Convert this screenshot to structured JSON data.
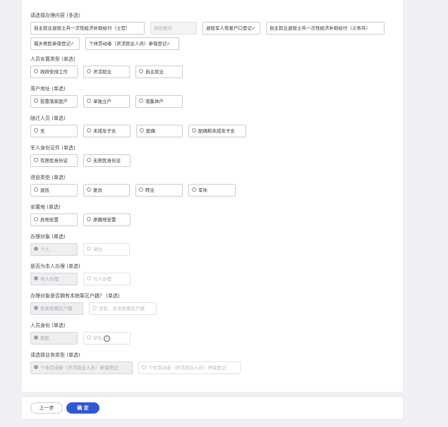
{
  "sections": [
    {
      "title": "请选择办理内容 (多选)",
      "options": [
        {
          "label": "自主就业退役士兵一次性经济补助给付（士官）",
          "state": "normal",
          "w": 162
        },
        {
          "label": "退役报到",
          "state": "disabled",
          "w": 66
        },
        {
          "label": "退役军人恢复户口登记",
          "state": "selected",
          "w": 82
        },
        {
          "label": "自主就业退役士兵一次性经济补助给付（义务兵）",
          "state": "normal",
          "w": 168
        },
        {
          "label": "城乡居民参保登记",
          "state": "selected",
          "w": 70
        },
        {
          "label": "个体劳动者（灵活就业人员）参保登记",
          "state": "selected",
          "w": 133
        }
      ]
    },
    {
      "title": "人员安置类型 (单选)",
      "options": [
        {
          "label": "政府安排工作",
          "state": "normal",
          "radio": true,
          "w": 67
        },
        {
          "label": "灵活就业",
          "state": "normal",
          "radio": true,
          "w": 66
        },
        {
          "label": "自主就业",
          "state": "normal",
          "radio": true,
          "w": 67
        }
      ]
    },
    {
      "title": "落户地址 (单选)",
      "options": [
        {
          "label": "投靠落家庭户",
          "state": "normal",
          "radio": true,
          "w": 67
        },
        {
          "label": "单独立户",
          "state": "normal",
          "radio": true,
          "w": 66
        },
        {
          "label": "落集体户",
          "state": "normal",
          "radio": true,
          "w": 67
        }
      ]
    },
    {
      "title": "随迁人员 (单选)",
      "options": [
        {
          "label": "无",
          "state": "normal",
          "radio": true,
          "w": 67
        },
        {
          "label": "未成年子女",
          "state": "normal",
          "radio": true,
          "w": 67
        },
        {
          "label": "配偶",
          "state": "normal",
          "radio": true,
          "w": 66
        },
        {
          "label": "配偶和未成年子女",
          "state": "normal",
          "radio": true,
          "w": 82
        }
      ]
    },
    {
      "title": "军人身份证件 (单选)",
      "options": [
        {
          "label": "有居民身份证",
          "state": "normal",
          "radio": true,
          "w": 67
        },
        {
          "label": "无居民身份证",
          "state": "normal",
          "radio": true,
          "w": 67
        }
      ]
    },
    {
      "title": "退役类型 (单选)",
      "options": [
        {
          "label": "退伍",
          "state": "normal",
          "radio": true,
          "w": 67
        },
        {
          "label": "复员",
          "state": "normal",
          "radio": true,
          "w": 66
        },
        {
          "label": "转业",
          "state": "normal",
          "radio": true,
          "w": 67
        },
        {
          "label": "军休",
          "state": "normal",
          "radio": true,
          "w": 67
        }
      ]
    },
    {
      "title": "安置地 (单选)",
      "options": [
        {
          "label": "异地安置",
          "state": "normal",
          "radio": true,
          "w": 67
        },
        {
          "label": "原籍地安置",
          "state": "normal",
          "radio": true,
          "w": 67
        }
      ]
    },
    {
      "title": "办理对象 (单选)",
      "options": [
        {
          "label": "个人",
          "state": "dis-sel",
          "radio": true,
          "w": 67
        },
        {
          "label": "单位",
          "state": "muted",
          "radio": true,
          "w": 66
        }
      ]
    },
    {
      "title": "是否为本人办理 (单选)",
      "options": [
        {
          "label": "本人办理",
          "state": "dis-sel",
          "radio": true,
          "w": 67
        },
        {
          "label": "代人办理",
          "state": "muted",
          "radio": true,
          "w": 67
        }
      ]
    },
    {
      "title": "办理对象是否拥有本统筹区户籍？ (单选)",
      "options": [
        {
          "label": "有本统筹区户籍",
          "state": "dis-sel",
          "radio": true,
          "w": 75
        },
        {
          "label": "没有、非本统筹区户籍",
          "state": "muted",
          "radio": true,
          "w": 96
        }
      ]
    },
    {
      "title": "人员身份 (单选)",
      "options": [
        {
          "label": "居民",
          "state": "dis-sel",
          "radio": true,
          "w": 67
        },
        {
          "label": "学生",
          "state": "muted",
          "radio": true,
          "info": true,
          "w": 67
        }
      ]
    },
    {
      "title": "请选择业务类型 (单选)",
      "options": [
        {
          "label": "个体劳动者（灵活就业人员）参保登记",
          "state": "dis-sel",
          "radio": true,
          "w": 145
        },
        {
          "label": "个体劳动者（灵活就业人员）停保登记",
          "state": "muted",
          "radio": true,
          "w": 145
        }
      ]
    }
  ],
  "footer": {
    "prev_label": "上一步",
    "ok_label": "确 定"
  },
  "colors": {
    "accent": "#2e58d8"
  }
}
